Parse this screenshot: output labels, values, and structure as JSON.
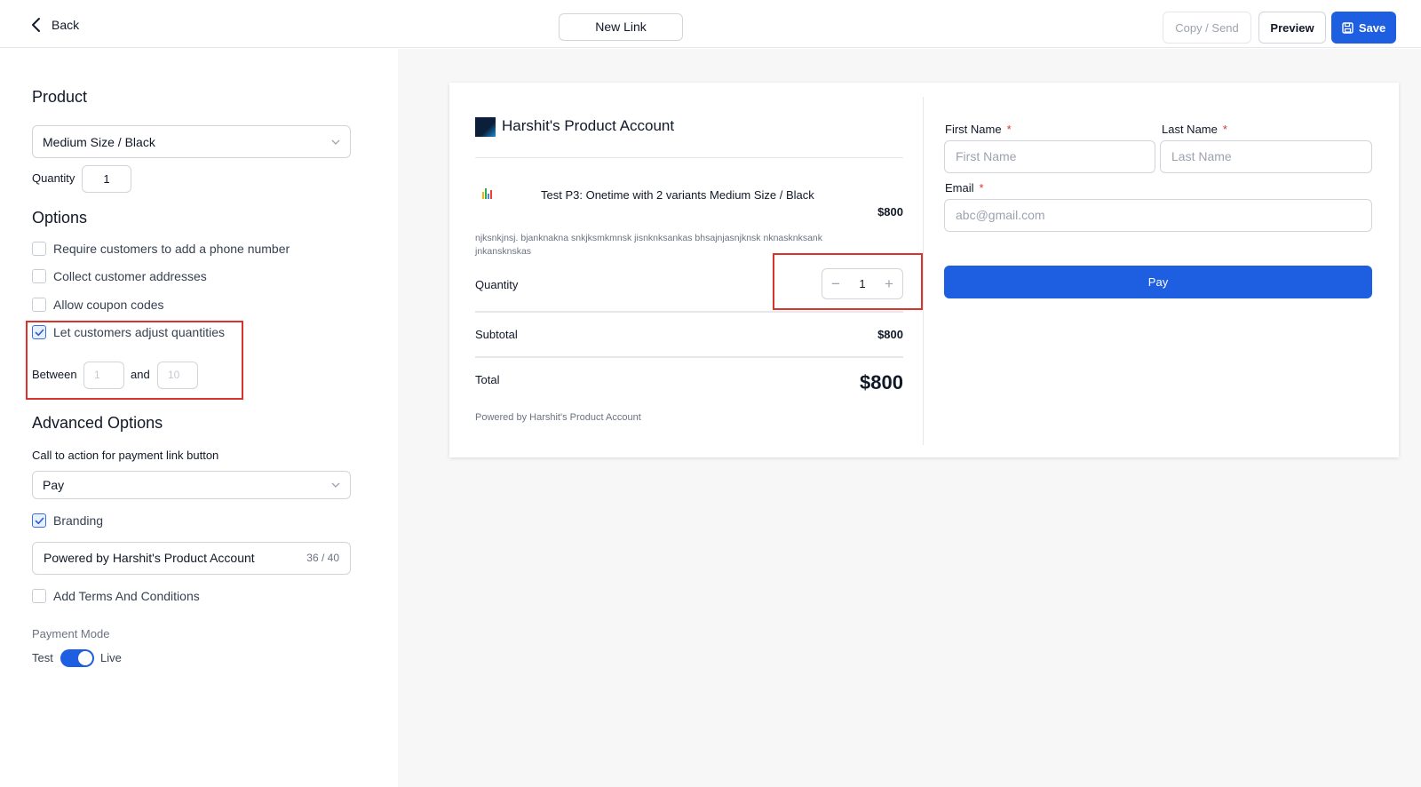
{
  "topbar": {
    "back_label": "Back",
    "link_name": "New Link",
    "copy_send_label": "Copy / Send",
    "preview_label": "Preview",
    "save_label": "Save"
  },
  "product_section": {
    "heading": "Product",
    "selected_variant": "Medium Size / Black",
    "quantity_label": "Quantity",
    "quantity_value": "1"
  },
  "options_section": {
    "heading": "Options",
    "items": [
      {
        "label": "Require customers to add a phone number",
        "checked": false
      },
      {
        "label": "Collect customer addresses",
        "checked": false
      },
      {
        "label": "Allow coupon codes",
        "checked": false
      },
      {
        "label": "Let customers adjust quantities",
        "checked": true
      }
    ],
    "between_label": "Between",
    "and_label": "and",
    "min_placeholder": "1",
    "max_placeholder": "10"
  },
  "advanced_section": {
    "heading": "Advanced Options",
    "cta_label": "Call to action for payment link button",
    "cta_value": "Pay",
    "branding_label": "Branding",
    "branding_checked": true,
    "branding_text": "Powered by Harshit's Product Account",
    "branding_count": "36 / 40",
    "terms_label": "Add Terms And Conditions",
    "terms_checked": false,
    "payment_mode_label": "Payment Mode",
    "mode_test": "Test",
    "mode_live": "Live",
    "live_enabled": true
  },
  "preview": {
    "account_name": "Harshit's Product Account",
    "product_name": "Test P3: Onetime with 2 variants Medium Size / Black",
    "product_price": "$800",
    "product_description": "njksnkjnsj. bjanknakna snkjksmkmnsk jisnknksankas bhsajnjasnjknsk nknasknksank jnkansknskas",
    "quantity_label": "Quantity",
    "quantity_value": "1",
    "minus_glyph": "−",
    "plus_glyph": "+",
    "subtotal_label": "Subtotal",
    "subtotal_value": "$800",
    "total_label": "Total",
    "total_value": "$800",
    "powered_by": "Powered by Harshit's Product Account",
    "form": {
      "first_name_label": "First Name",
      "first_name_placeholder": "First Name",
      "last_name_label": "Last Name",
      "last_name_placeholder": "Last Name",
      "email_label": "Email",
      "email_placeholder": "abc@gmail.com",
      "required_mark": "*",
      "pay_label": "Pay"
    }
  },
  "colors": {
    "primary": "#1d5fe0",
    "highlight_border": "#d9342b",
    "preview_background": "#f7f7f8"
  },
  "icons": [
    "chevron-left-icon",
    "save-disk-icon",
    "chevron-down-icon",
    "checkmark-icon",
    "account-logo-icon",
    "product-thumbnail-icon"
  ]
}
